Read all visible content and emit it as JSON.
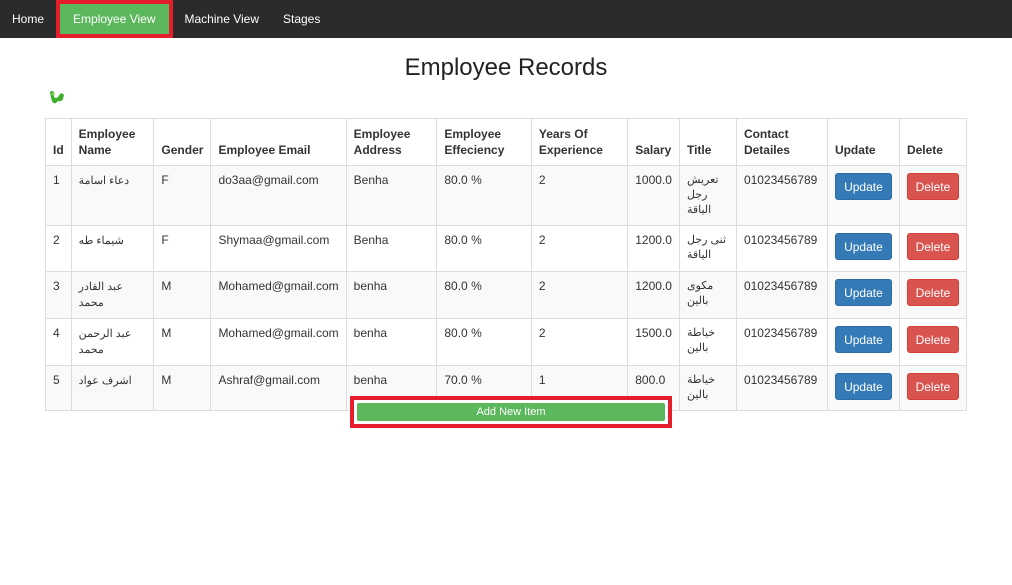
{
  "nav": {
    "home": "Home",
    "employee_view": "Employee View",
    "machine_view": "Machine View",
    "stages": "Stages",
    "active_color": "#5cb85c",
    "bar_color": "#2b2b2b"
  },
  "page_title": "Employee Records",
  "table": {
    "headers": {
      "id": "Id",
      "name": "Employee Name",
      "gender": "Gender",
      "email": "Employee Email",
      "address": "Employee Address",
      "efficiency": "Employee Effeciency",
      "experience": "Years Of Experience",
      "salary": "Salary",
      "title": "Title",
      "contact": "Contact Detailes",
      "update": "Update",
      "delete": "Delete"
    },
    "rows": [
      {
        "id": "1",
        "name": "دعاء اسامة",
        "gender": "F",
        "email": "do3aa@gmail.com",
        "address": "Benha",
        "efficiency": "80.0 %",
        "experience": "2",
        "salary": "1000.0",
        "title": "تعريش رجل الياقة",
        "contact": "01023456789",
        "update": "Update",
        "delete": "Delete"
      },
      {
        "id": "2",
        "name": "شيماء طه",
        "gender": "F",
        "email": "Shymaa@gmail.com",
        "address": "Benha",
        "efficiency": "80.0 %",
        "experience": "2",
        "salary": "1200.0",
        "title": "ثنى رجل الياقة",
        "contact": "01023456789",
        "update": "Update",
        "delete": "Delete"
      },
      {
        "id": "3",
        "name": "عبد القادر محمد",
        "gender": "M",
        "email": "Mohamed@gmail.com",
        "address": "benha",
        "efficiency": "80.0 %",
        "experience": "2",
        "salary": "1200.0",
        "title": "مكوى بالين",
        "contact": "01023456789",
        "update": "Update",
        "delete": "Delete"
      },
      {
        "id": "4",
        "name": "عبد الرحمن محمد",
        "gender": "M",
        "email": "Mohamed@gmail.com",
        "address": "benha",
        "efficiency": "80.0 %",
        "experience": "2",
        "salary": "1500.0",
        "title": "خياطة بالين",
        "contact": "01023456789",
        "update": "Update",
        "delete": "Delete"
      },
      {
        "id": "5",
        "name": "اشرف عواد",
        "gender": "M",
        "email": "Ashraf@gmail.com",
        "address": "benha",
        "efficiency": "70.0 %",
        "experience": "1",
        "salary": "800.0",
        "title": "خياطة بالين",
        "contact": "01023456789",
        "update": "Update",
        "delete": "Delete"
      }
    ]
  },
  "add_button": "Add New Item",
  "colors": {
    "update": "#337ab7",
    "delete": "#d9534f",
    "add": "#5cb85c",
    "highlight": "#e41e2b"
  },
  "icons": {
    "decorative": "broken-image-icon"
  }
}
